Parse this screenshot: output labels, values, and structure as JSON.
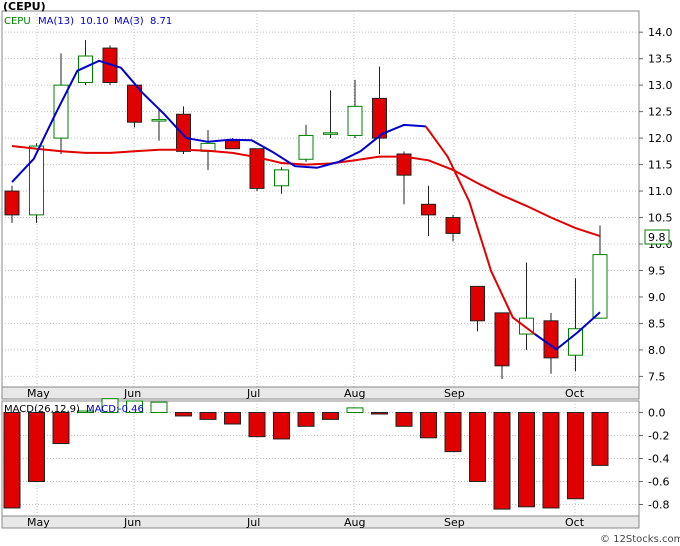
{
  "chart_data": [
    {
      "type": "candlestick",
      "title": "(CEPU)",
      "legend": [
        {
          "label": "CEPU",
          "value": "",
          "color": "#008000"
        },
        {
          "label": "MA(13)",
          "value": "10.10",
          "color": "#0000cc"
        },
        {
          "label": "MA(3)",
          "value": "8.71",
          "color": "#0000cc"
        }
      ],
      "price_tag": "9.8",
      "ylim": [
        7.3,
        14.4
      ],
      "y_ticks": [
        "14.0",
        "13.5",
        "13.0",
        "12.5",
        "12.0",
        "11.5",
        "11.0",
        "10.5",
        "10.0",
        "9.5",
        "9.0",
        "8.5",
        "8.0",
        "7.5"
      ],
      "x_ticks": [
        "May",
        "Jun",
        "Jul",
        "Aug",
        "Sep",
        "Oct"
      ],
      "grid": true,
      "candles": [
        {
          "open": 11.0,
          "high": 11.1,
          "low": 10.4,
          "close": 10.55
        },
        {
          "open": 10.55,
          "high": 11.9,
          "low": 10.4,
          "close": 11.85
        },
        {
          "open": 12.0,
          "high": 13.6,
          "low": 11.7,
          "close": 13.0
        },
        {
          "open": 13.05,
          "high": 13.85,
          "low": 13.0,
          "close": 13.55
        },
        {
          "open": 13.7,
          "high": 13.75,
          "low": 13.0,
          "close": 13.05
        },
        {
          "open": 13.0,
          "high": 13.05,
          "low": 12.2,
          "close": 12.3
        },
        {
          "open": 12.35,
          "high": 12.55,
          "low": 11.95,
          "close": 12.35
        },
        {
          "open": 12.45,
          "high": 12.6,
          "low": 11.7,
          "close": 11.75
        },
        {
          "open": 11.75,
          "high": 12.15,
          "low": 11.4,
          "close": 11.9
        },
        {
          "open": 11.95,
          "high": 12.0,
          "low": 11.85,
          "close": 11.8
        },
        {
          "open": 11.8,
          "high": 11.8,
          "low": 11.0,
          "close": 11.05
        },
        {
          "open": 11.1,
          "high": 11.45,
          "low": 10.95,
          "close": 11.4
        },
        {
          "open": 11.6,
          "high": 12.25,
          "low": 11.55,
          "close": 12.05
        },
        {
          "open": 12.1,
          "high": 12.9,
          "low": 12.0,
          "close": 12.1
        },
        {
          "open": 12.05,
          "high": 13.1,
          "low": 12.0,
          "close": 12.6
        },
        {
          "open": 12.75,
          "high": 13.35,
          "low": 11.7,
          "close": 12.0
        },
        {
          "open": 11.7,
          "high": 11.75,
          "low": 10.75,
          "close": 11.3
        },
        {
          "open": 10.75,
          "high": 11.1,
          "low": 10.15,
          "close": 10.55
        },
        {
          "open": 10.5,
          "high": 10.55,
          "low": 10.05,
          "close": 10.2
        },
        {
          "open": 9.2,
          "high": 9.2,
          "low": 8.35,
          "close": 8.55
        },
        {
          "open": 8.7,
          "high": 8.7,
          "low": 7.45,
          "close": 7.7
        },
        {
          "open": 8.3,
          "high": 9.65,
          "low": 8.0,
          "close": 8.6
        },
        {
          "open": 8.55,
          "high": 8.7,
          "low": 7.55,
          "close": 7.85
        },
        {
          "open": 7.9,
          "high": 9.35,
          "low": 7.6,
          "close": 8.4
        },
        {
          "open": 8.6,
          "high": 10.35,
          "low": 8.6,
          "close": 9.8
        }
      ],
      "ma13": [
        11.85,
        11.8,
        11.75,
        11.72,
        11.72,
        11.75,
        11.78,
        11.78,
        11.76,
        11.72,
        11.64,
        11.53,
        11.5,
        11.52,
        11.58,
        11.65,
        11.65,
        11.58,
        11.4,
        11.15,
        10.92,
        10.72,
        10.5,
        10.3,
        10.15
      ],
      "ma13_start": 0,
      "ma3": [
        11.17,
        11.61,
        12.46,
        13.27,
        13.46,
        13.33,
        12.85,
        12.45,
        12.0,
        11.93,
        11.97,
        11.96,
        11.73,
        11.47,
        11.44,
        11.55,
        11.75,
        12.08,
        12.25,
        12.22,
        11.65,
        10.8,
        9.49,
        8.61,
        8.3,
        8.01,
        8.34,
        8.71
      ],
      "ma3_start": 0
    },
    {
      "type": "bar",
      "title": "MACD(26,12,9)",
      "legend": [
        {
          "label": "MACD(26,12,9)",
          "value": "",
          "color": "#000000"
        },
        {
          "label": "MACD:",
          "value": "-0.46",
          "color": "#0000cc"
        }
      ],
      "ylim": [
        -0.9,
        0.1
      ],
      "y_ticks": [
        "0.0",
        "-0.2",
        "-0.4",
        "-0.6",
        "-0.8"
      ],
      "x_ticks": [
        "May",
        "Jun",
        "Jul",
        "Aug",
        "Sep",
        "Oct"
      ],
      "values": [
        -0.83,
        -0.6,
        -0.27,
        0.0,
        0.12,
        0.1,
        0.09,
        -0.03,
        -0.06,
        -0.1,
        -0.21,
        -0.23,
        -0.12,
        -0.06,
        0.04,
        -0.01,
        -0.12,
        -0.22,
        -0.34,
        -0.6,
        -0.84,
        -0.82,
        -0.83,
        -0.75,
        -0.46
      ]
    }
  ],
  "footer": {
    "watermark": "© 12Stocks.com"
  }
}
